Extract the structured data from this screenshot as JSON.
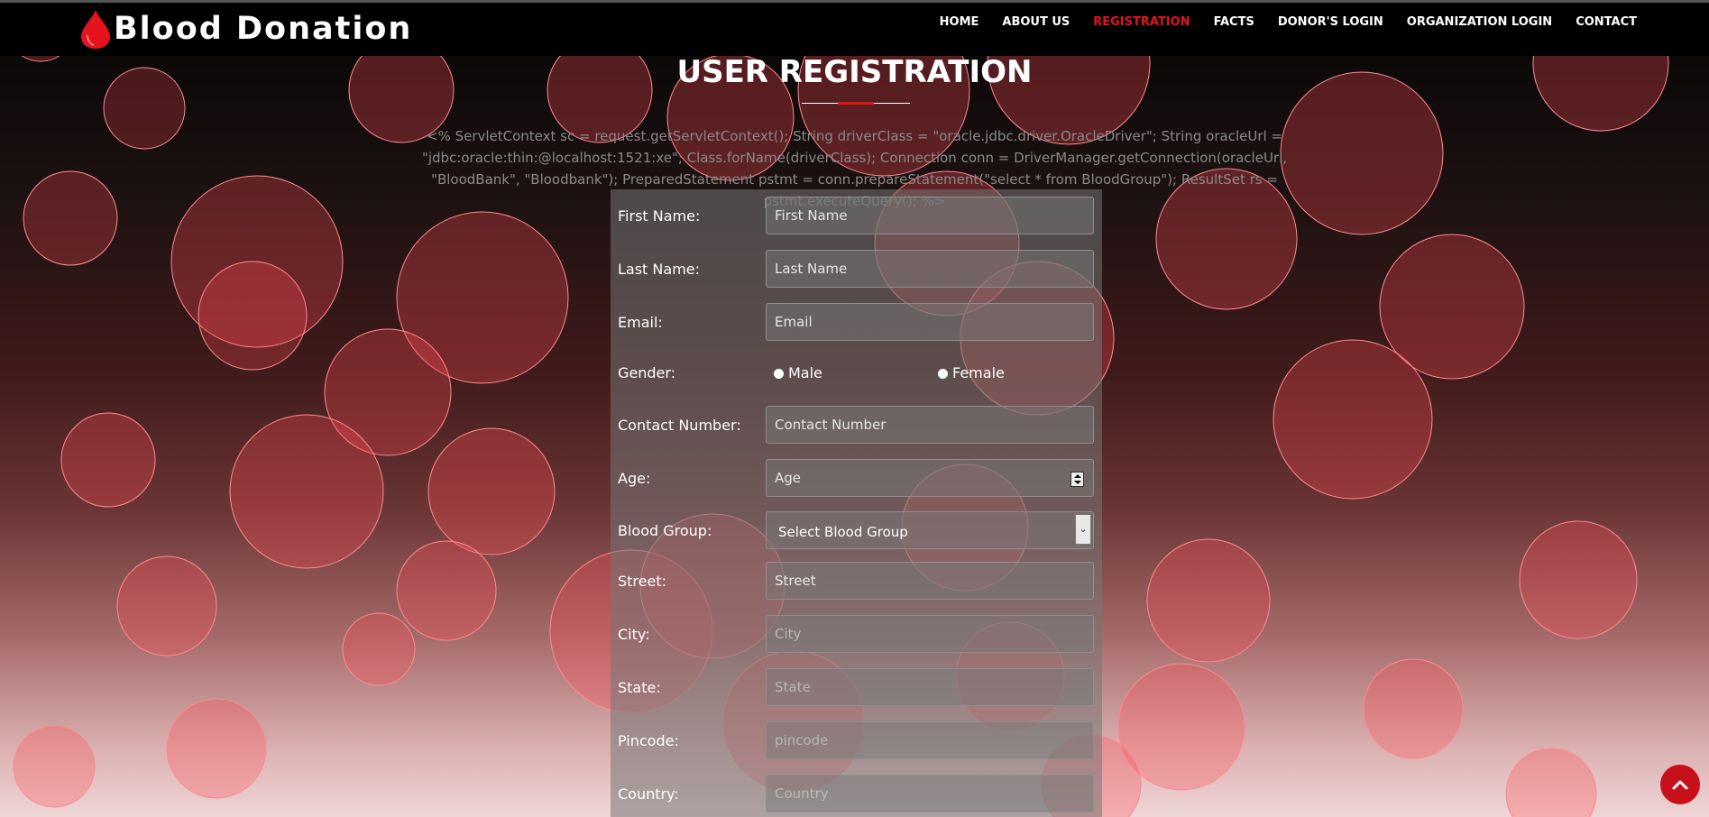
{
  "brand": {
    "name": "Blood Donation",
    "logo_icon": "blood-drop-icon",
    "accent_color": "#e5131b"
  },
  "nav": {
    "items": [
      {
        "label": "HOME",
        "active": false
      },
      {
        "label": "ABOUT US",
        "active": false
      },
      {
        "label": "REGISTRATION",
        "active": true
      },
      {
        "label": "FACTS",
        "active": false
      },
      {
        "label": "DONOR'S LOGIN",
        "active": false
      },
      {
        "label": "ORGANIZATION LOGIN",
        "active": false
      },
      {
        "label": "CONTACT",
        "active": false
      }
    ]
  },
  "page": {
    "title": "USER REGISTRATION",
    "code_text": "<% ServletContext sc = request.getServletContext(); String driverClass = \"oracle.jdbc.driver.OracleDriver\"; String oracleUrl = \"jdbc:oracle:thin:@localhost:1521:xe\"; Class.forName(driverClass); Connection conn = DriverManager.getConnection(oracleUrl, \"BloodBank\", \"Bloodbank\"); PreparedStatement pstmt = conn.prepareStatement(\"select * from BloodGroup\"); ResultSet rs = pstmt.executeQuery(); %>"
  },
  "form": {
    "first_name": {
      "label": "First Name:",
      "placeholder": "First Name"
    },
    "last_name": {
      "label": "Last Name:",
      "placeholder": "Last Name"
    },
    "email": {
      "label": "Email:",
      "placeholder": "Email"
    },
    "gender": {
      "label": "Gender:",
      "options": [
        "Male",
        "Female"
      ]
    },
    "contact": {
      "label": "Contact Number:",
      "placeholder": "Contact Number"
    },
    "age": {
      "label": "Age:",
      "placeholder": "Age"
    },
    "blood_group": {
      "label": "Blood Group:",
      "selected": "Select Blood Group"
    },
    "street": {
      "label": "Street:",
      "placeholder": "Street"
    },
    "city": {
      "label": "City:",
      "placeholder": "City"
    },
    "state": {
      "label": "State:",
      "placeholder": "State"
    },
    "pincode": {
      "label": "Pincode:",
      "placeholder": "pincode"
    },
    "country": {
      "label": "Country:",
      "placeholder": "Country"
    }
  },
  "scroll_top": {
    "icon": "chevron-up-icon",
    "color": "#c8101a"
  }
}
